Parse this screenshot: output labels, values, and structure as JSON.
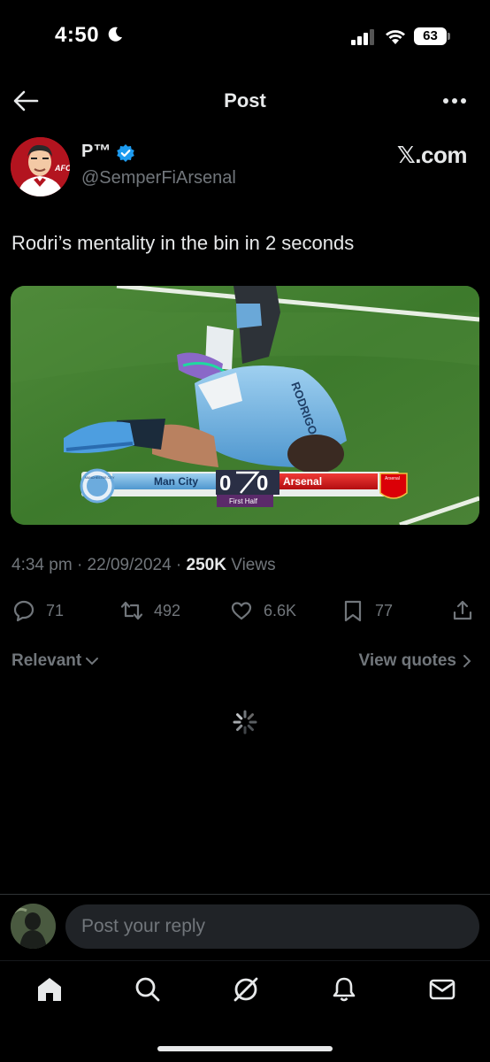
{
  "status_bar": {
    "time": "4:50",
    "battery": "63"
  },
  "header": {
    "title": "Post"
  },
  "post": {
    "display_name": "P™",
    "handle": "@SemperFiArsenal",
    "watermark": "𝕏.com",
    "text": "Rodri’s mentality in the bin in 2 seconds",
    "media": {
      "home_team": "Man City",
      "away_team": "Arsenal",
      "home_score": "0",
      "away_score": "0",
      "period": "First Half",
      "home_badge_text": "MANCHESTER CITY",
      "away_badge_text": "Arsenal",
      "shirt_name": "RODRIGO"
    },
    "time": "4:34 pm",
    "date": "22/09/2024",
    "views_count": "250K",
    "views_label": "Views",
    "separator": "·"
  },
  "actions": {
    "replies": "71",
    "reposts": "492",
    "likes": "6.6K",
    "bookmarks": "77"
  },
  "sort": {
    "relevant": "Relevant",
    "view_quotes": "View quotes"
  },
  "reply": {
    "placeholder": "Post your reply"
  },
  "colors": {
    "background": "#000000",
    "text": "#e7e9ea",
    "muted": "#71767b",
    "verified": "#1d9bf0",
    "city_blue": "#6cabdd",
    "arsenal_red": "#db0007"
  },
  "icons": [
    "back-icon",
    "more-icon",
    "verified-icon",
    "reply-icon",
    "repost-icon",
    "like-icon",
    "bookmark-icon",
    "share-icon",
    "chevron-down-icon",
    "chevron-right-icon",
    "spinner-icon",
    "home-icon",
    "search-icon",
    "grok-icon",
    "notifications-icon",
    "messages-icon"
  ]
}
